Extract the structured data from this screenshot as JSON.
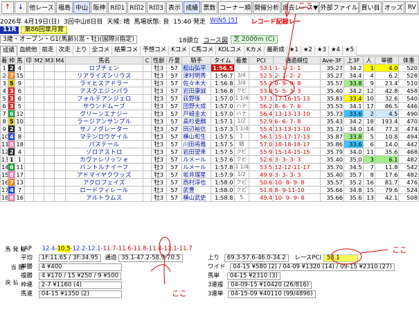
{
  "toolbar": {
    "items": [
      {
        "label": "↑",
        "name": "up-arrow-button"
      },
      {
        "label": "↓",
        "name": "down-arrow-button"
      },
      {
        "label": "他レース",
        "name": "other-race-button"
      },
      {
        "label": "福島",
        "name": "venue-fukushima-button"
      },
      {
        "label": "中山",
        "name": "venue-nakayama-button",
        "active": true
      },
      {
        "label": "阪神",
        "name": "venue-hanshin-button"
      },
      {
        "label": "R印1",
        "name": "rmark1-button"
      },
      {
        "label": "R印2",
        "name": "rmark2-button"
      },
      {
        "label": "R印3",
        "name": "rmark3-button"
      },
      {
        "label": "表示",
        "name": "display-button"
      },
      {
        "label": "成績",
        "name": "results-button",
        "active": true
      },
      {
        "label": "票数",
        "name": "votes-button"
      },
      {
        "label": "コーナー順",
        "name": "corner-order-button"
      },
      {
        "label": "開催分析",
        "name": "meeting-analysis-button"
      },
      {
        "label": "過去レース▼",
        "name": "past-race-button"
      },
      {
        "label": "外部ファイル",
        "name": "external-file-button"
      },
      {
        "label": "買い目",
        "name": "bet-button"
      },
      {
        "label": "オッズ",
        "name": "odds-button"
      },
      {
        "label": "RV",
        "name": "rv-button"
      }
    ]
  },
  "info": {
    "date": "2026年 4月19日(日)",
    "meeting": "3回中山8日目",
    "weather": "天候: 晴",
    "track": "馬場状態: 良",
    "post_time": "15:40 発走",
    "win5": "WIN5 [5]",
    "record": "レコード記録レー"
  },
  "race": {
    "number": "11R",
    "name": "第86回皐月賞"
  },
  "conditions": {
    "class": "3歳・オープン・G1(馬齢)(混・牡)(国際)(指定)",
    "heads": "18頭立",
    "course_label": "コース図",
    "course": "芝 2000m (C)"
  },
  "tabs": [
    "成績",
    "血統他",
    "前走",
    "次走",
    "上り",
    "全コメ",
    "結果コメ",
    "予想コメ",
    "Kコメ",
    "C馬コメ",
    "KOLコメ",
    "Kカメ",
    "最新成",
    "★1",
    "★2",
    "★3",
    "★4",
    "★5"
  ],
  "columns": [
    "着",
    "枠",
    "馬",
    "印",
    "M2",
    "M3",
    "M4",
    "馬名",
    "C",
    "性齢",
    "斤量",
    "騎手",
    "タイム",
    "着差",
    "PCI",
    "通過順位",
    "Ave-3F",
    "上3F",
    "人",
    "単勝",
    "体重"
  ],
  "rows": [
    {
      "pos": "1",
      "waku": "2",
      "uma": "4",
      "name": "ロブチェン",
      "sex": "牡3",
      "kg": "57",
      "jockey": "松山弘平",
      "time": "1:56.5",
      "diff": "",
      "pci": "53.1",
      "pass": "1- 1- 1- 1",
      "ave": "35.27",
      "agari": "34.2",
      "pop": "1",
      "odds": "4.0",
      "wt": "520"
    },
    {
      "pos": "2",
      "waku": "7",
      "uma": "15",
      "name": "リアライズシリウス",
      "sex": "牡3",
      "kg": "57",
      "jockey": "津村明秀",
      "time": "1:56.7",
      "diff": "3/4",
      "pci": "52.5",
      "pass": "2- 2- 2- 2",
      "ave": "35.27",
      "agari": "34.4",
      "pop": "4",
      "odds": "6.2",
      "wt": "528"
    },
    {
      "pos": "3",
      "waku": "5",
      "uma": "9",
      "name": "ライヒスアドラー",
      "sex": "牡3",
      "kg": "57",
      "jockey": "佐々木大",
      "time": "1:56.8",
      "diff": "3/4",
      "pci": "55.2",
      "pass": "0- 9- 9- 8",
      "ave": "35.57",
      "agari": "33.8",
      "pop": "9",
      "odds": "23.4",
      "wt": "510"
    },
    {
      "pos": "4",
      "waku": "3",
      "uma": "6",
      "name": "アスクエジンバラ",
      "sex": "牡3",
      "kg": "57",
      "jockey": "岩田康誠",
      "time": "1:56.8",
      "diff": "クビ",
      "pci": "53.0",
      "pass": "5- 5- 3- 3",
      "ave": "35.40",
      "agari": "34.2",
      "pop": "12",
      "odds": "42.8",
      "wt": "458"
    },
    {
      "pos": "5",
      "waku": "3",
      "uma": "6",
      "name": "フォルテアンジェロ",
      "sex": "牡3",
      "kg": "57",
      "jockey": "荻野琢",
      "time": "1:57.0",
      "diff": "1 1/4",
      "pci": "57.3",
      "pass": "17-16-15-13",
      "ave": "35.83",
      "agari": "33.4",
      "pop": "10",
      "odds": "32.6",
      "wt": "540"
    },
    {
      "pos": "6",
      "waku": "3",
      "uma": "5",
      "name": "サウンドムーブ",
      "sex": "牡3",
      "kg": "57",
      "jockey": "団野大成",
      "time": "1:57.0",
      "diff": "ハナ",
      "pci": "56.2",
      "pass": "8- 6- 7- 6",
      "ave": "35.53",
      "agari": "34.1",
      "pop": "17",
      "odds": "86.5",
      "wt": "446"
    },
    {
      "pos": "7",
      "waku": "6",
      "uma": "12",
      "name": "グリーンエナジー",
      "sex": "牡3",
      "kg": "57",
      "jockey": "戸崎圭太",
      "time": "1:57.0",
      "diff": "ハナ",
      "pci": "56.4",
      "pass": "13-13-13-10",
      "ave": "35.73",
      "agari": "33.6",
      "pop": "2",
      "odds": "4.5",
      "wt": "490"
    },
    {
      "pos": "8",
      "waku": "5",
      "uma": "10",
      "name": "ラージアンサンブル",
      "sex": "牡3",
      "kg": "57",
      "jockey": "高杉吏麒",
      "time": "1:57.1",
      "diff": "1/2",
      "pci": "52.9",
      "pass": "6- 6- 7- 8",
      "ave": "35.43",
      "agari": "34.2",
      "pop": "18",
      "odds": "193.4",
      "wt": "470"
    },
    {
      "pos": "9",
      "waku": "2",
      "uma": "3",
      "name": "サノノグレーター",
      "sex": "牡3",
      "kg": "57",
      "jockey": "田辺裕信",
      "time": "1:57.3",
      "diff": "1 1/4",
      "pci": "55.4",
      "pass": "13-13-13-10",
      "ave": "35.73",
      "agari": "34.0",
      "pop": "14",
      "odds": "77.3",
      "wt": "474"
    },
    {
      "pos": "10",
      "waku": "4",
      "uma": "8",
      "name": "マテンロウゲイル",
      "sex": "牡3",
      "kg": "57",
      "jockey": "横山和生",
      "time": "1:57.5",
      "diff": "1",
      "pci": "56.1",
      "pass": "15-17-17-13",
      "ave": "35.87",
      "agari": "33.8",
      "pop": "5",
      "odds": "10.8",
      "wt": "494"
    },
    {
      "pos": "11",
      "waku": "8",
      "uma": "18",
      "name": "パステール",
      "sex": "牡3",
      "kg": "57",
      "jockey": "川田将雅",
      "time": "1:57.5",
      "diff": "頭",
      "pci": "57.0",
      "pass": "18-18-18-17",
      "ave": "35.86",
      "agari": "33.6",
      "pop": "6",
      "odds": "14.0",
      "wt": "442"
    },
    {
      "pos": "12",
      "waku": "2",
      "uma": "4",
      "name": "ゾロアストロ",
      "sex": "牡3",
      "kg": "57",
      "jockey": "岩田望来",
      "time": "1:57.5",
      "diff": "クビ",
      "pci": "55.9",
      "pass": "15-14-15-15",
      "ave": "35.79",
      "agari": "34.0",
      "pop": "11",
      "odds": "35.6",
      "wt": "468"
    },
    {
      "pos": "13",
      "waku": "1",
      "uma": "1",
      "name": "カヴァレリッツォ",
      "sex": "牡3",
      "kg": "57",
      "jockey": "ルメール",
      "time": "1:57.6",
      "diff": "クビ",
      "pci": "52.6",
      "pass": "3- 3- 3- 3",
      "ave": "35.40",
      "agari": "35.0",
      "pop": "3",
      "odds": "6.1",
      "wt": "482"
    },
    {
      "pos": "14",
      "waku": "6",
      "uma": "11",
      "name": "バントルナイーフ",
      "sex": "牡3",
      "kg": "57",
      "jockey": "ルメール",
      "time": "1:57.8",
      "diff": "1 1/4",
      "pci": "53.5",
      "pass": "12-12-11-17",
      "ave": "35.70",
      "agari": "34.5",
      "pop": "7",
      "odds": "11.8",
      "wt": "542"
    },
    {
      "pos": "15",
      "waku": "8",
      "uma": "17",
      "name": "アドマイヤクワッズ",
      "sex": "牡3",
      "kg": "57",
      "jockey": "坂井瑠星",
      "time": "1:57.9",
      "diff": "1/2",
      "pci": "49.9",
      "pass": "3- 3- 3- 3",
      "ave": "35.40",
      "agari": "35.7",
      "pop": "8",
      "odds": "17.6",
      "wt": "482"
    },
    {
      "pos": "16",
      "waku": "7",
      "uma": "13",
      "name": "アクロフェイズ",
      "sex": "牡3",
      "kg": "57",
      "jockey": "西村淳也",
      "time": "1:58.0",
      "diff": "クビ",
      "pci": "50.6",
      "pass": "10- 8- 9- 8",
      "ave": "35.57",
      "agari": "35.2",
      "pop": "16",
      "odds": "81.7",
      "wt": "476"
    },
    {
      "pos": "17",
      "waku": "4",
      "uma": "7",
      "name": "ロードフィレール",
      "sex": "牡3",
      "kg": "57",
      "jockey": "武豊",
      "time": "1:58.0",
      "diff": "クビ",
      "pci": "51.8",
      "pass": "8- 9-11-10",
      "ave": "35.66",
      "agari": "34.8",
      "pop": "15",
      "odds": "79.6",
      "wt": "524"
    },
    {
      "pos": "18",
      "waku": "8",
      "uma": "16",
      "name": "アルトラムス",
      "sex": "牡3",
      "kg": "57",
      "jockey": "横山武史",
      "time": "1:58.8",
      "diff": "5",
      "pci": "49.4",
      "pass": "10- 9- 9- 8",
      "ave": "35.66",
      "agari": "35.6",
      "pop": "13",
      "odds": "42.1",
      "wt": "508"
    }
  ],
  "summary": {
    "lap_label": "LAP",
    "laps": [
      "12.4",
      "10.5",
      "12.2",
      "12.1",
      "11.7",
      "11.6",
      "11.8",
      "11.4",
      "11.1",
      "11.7"
    ],
    "avg_label": "平均",
    "avg": "1F:11.65 / 3F:34.95",
    "pass_label": "通過",
    "pass": "35.1-47.2-58.9-70.5",
    "agari_label": "上り",
    "agari": "69.3-57.6-46.0-34.2",
    "race_pci_label": "レースPCI",
    "race_pci": "53.1",
    "tansho_label": "単勝",
    "tansho": "4 ¥400",
    "fukusho_label": "複勝",
    "fukusho": "4 ¥170 / 15 ¥250 / 9 ¥500",
    "wakuren_label": "枠連",
    "wakuren": "2-7 ¥1160 (4)",
    "umaren_label": "馬連",
    "umaren": "04-15 ¥1350 (2)",
    "wide_label": "ワイド",
    "wide": "04-15 ¥580 (2) / 04-09 ¥1320 (14) / 09-15 ¥2310 (27)",
    "umatan_label": "馬単",
    "umatan": "04-15 ¥2310 (3)",
    "sanrenpuku_label": "3連複",
    "sanrenpuku": "04-09-15 ¥10420 (26/816)",
    "sanrentan_label": "3連単",
    "sanrentan": "04-15-09 ¥40110 (99/4896)",
    "side_labels": [
      "総発馬",
      "配当",
      "払戻"
    ]
  },
  "annotations": [
    "ここ",
    "ここ",
    "ここ"
  ]
}
